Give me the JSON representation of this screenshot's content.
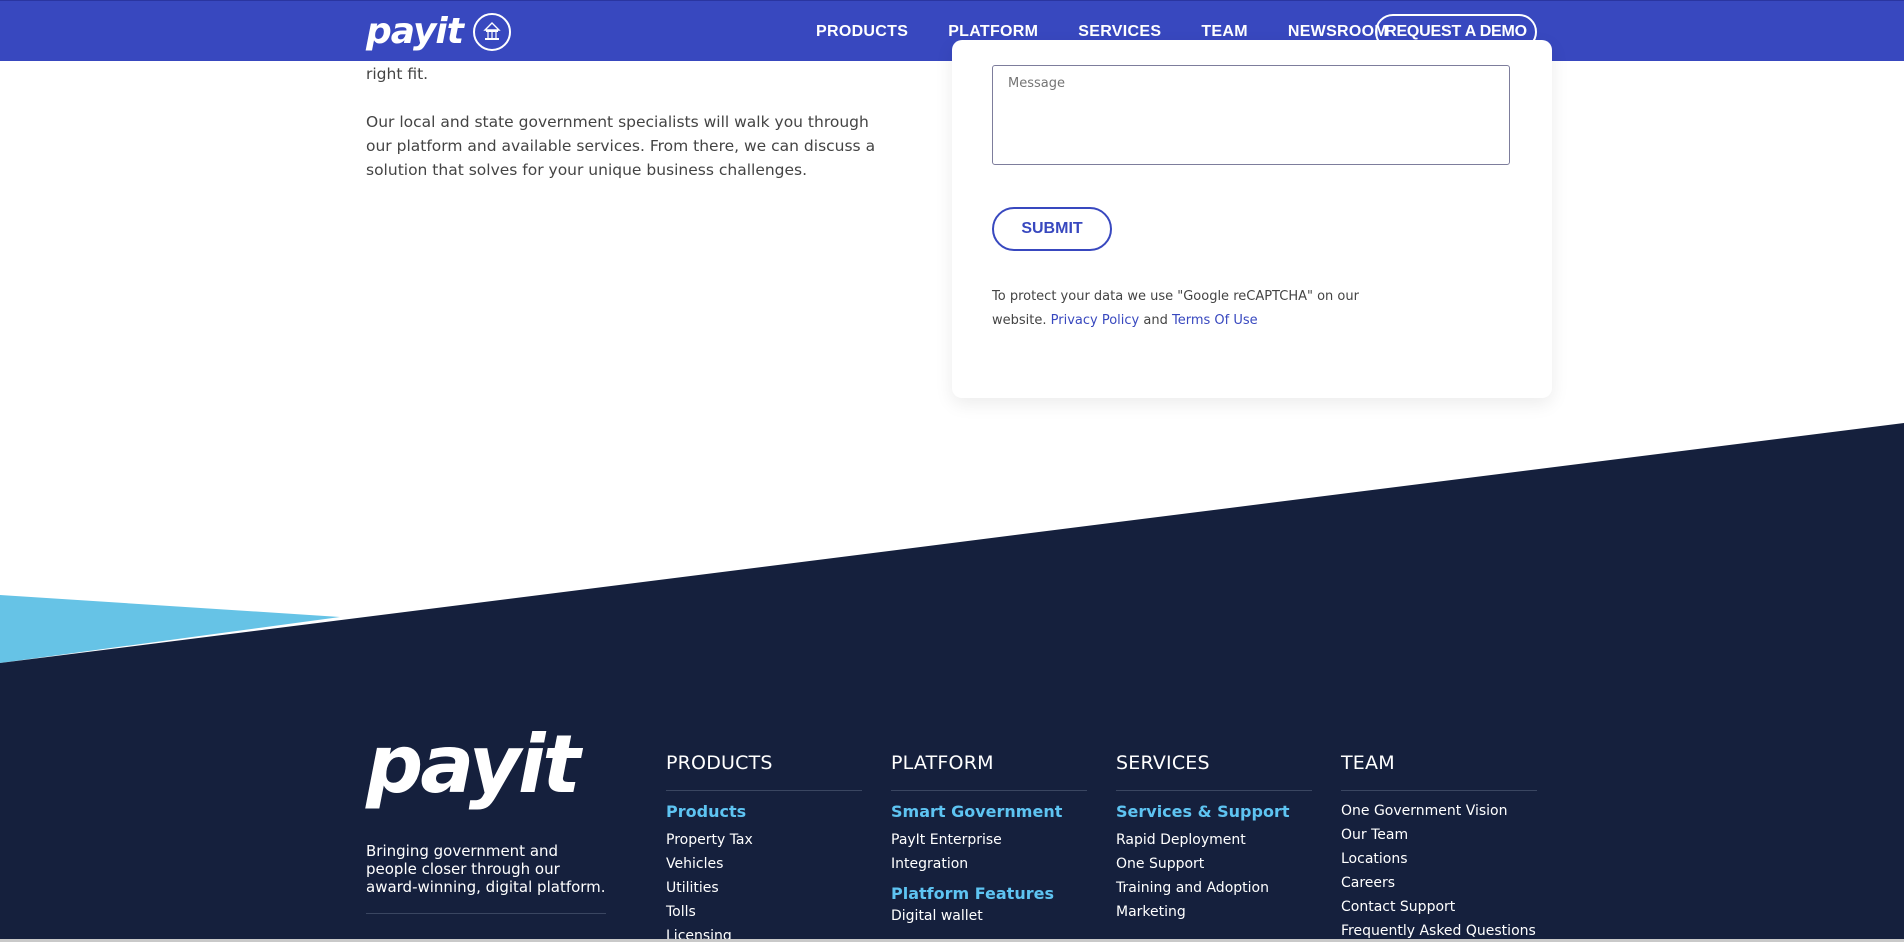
{
  "header": {
    "logo_text": "payit",
    "nav": [
      "PRODUCTS",
      "PLATFORM",
      "SERVICES",
      "TEAM",
      "NEWSROOM"
    ],
    "cta": "REQUEST A DEMO"
  },
  "intro": {
    "line_fragment": "right fit.",
    "paragraph": "Our local and state government specialists will walk you through our platform and available services. From there, we can discuss a solution that solves for your unique business challenges."
  },
  "form": {
    "message_placeholder": "Message",
    "submit_label": "SUBMIT",
    "captcha_text": "To protect your data we use \"Google reCAPTCHA\" on our website.",
    "privacy_link": "Privacy Policy",
    "and_text": "and",
    "terms_link": "Terms Of Use"
  },
  "colors": {
    "brand_blue": "#3848bf",
    "footer_navy": "#15203d",
    "light_blue": "#66c3e6",
    "accent_orange": "#f2a31b"
  },
  "footer": {
    "logo_text": "payit",
    "tagline": "Bringing government and people closer through our award-winning, digital platform.",
    "columns": [
      {
        "heading": "PRODUCTS",
        "groups": [
          {
            "title": "Products",
            "links": [
              "Property Tax",
              "Vehicles",
              "Utilities",
              "Tolls",
              "Licensing"
            ]
          }
        ]
      },
      {
        "heading": "PLATFORM",
        "groups": [
          {
            "title": "Smart Government",
            "links": [
              "PayIt Enterprise",
              "Integration"
            ]
          },
          {
            "title": "Platform Features",
            "links": [
              "Digital wallet"
            ]
          }
        ]
      },
      {
        "heading": "SERVICES",
        "groups": [
          {
            "title": "Services & Support",
            "links": [
              "Rapid Deployment",
              "One Support",
              "Training and Adoption",
              "Marketing"
            ]
          }
        ]
      },
      {
        "heading": "TEAM",
        "groups": [
          {
            "title": "",
            "links": [
              "One Government Vision",
              "Our Team",
              "Locations",
              "Careers",
              "Contact Support",
              "Frequently Asked Questions"
            ]
          }
        ]
      }
    ]
  }
}
